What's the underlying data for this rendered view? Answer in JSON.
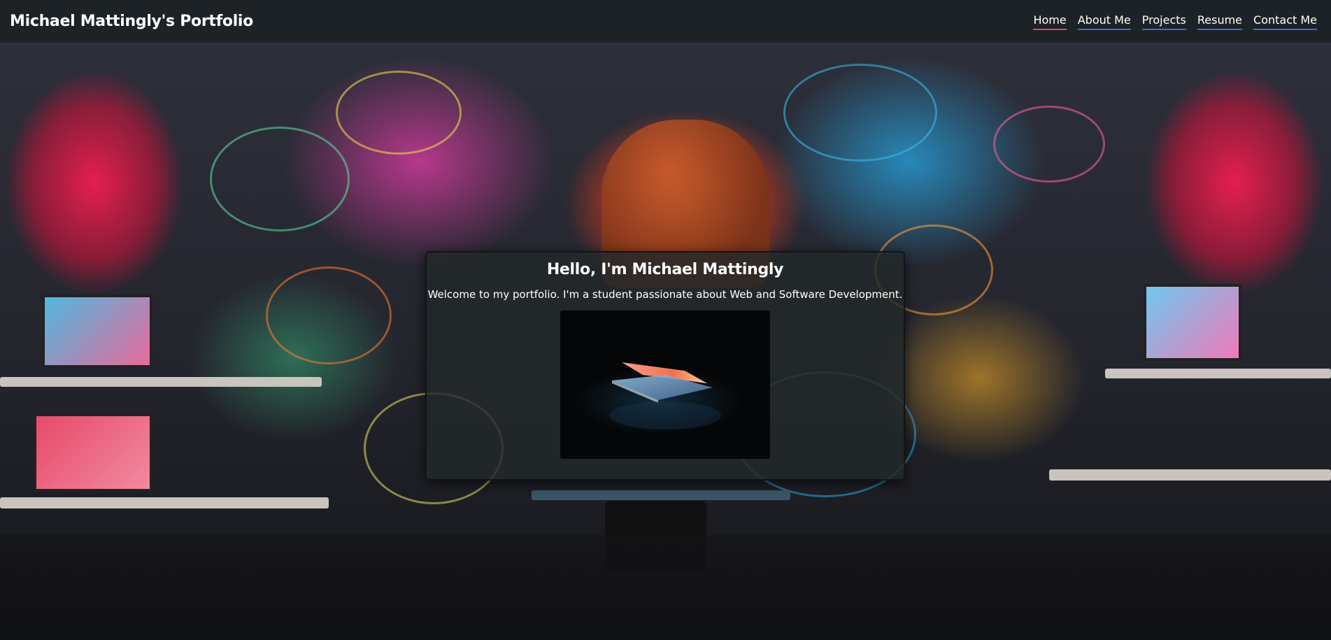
{
  "site": {
    "title": "Michael Mattingly's Portfolio"
  },
  "nav": {
    "items": [
      {
        "label": "Home",
        "active": true
      },
      {
        "label": "About Me",
        "active": false
      },
      {
        "label": "Projects",
        "active": false
      },
      {
        "label": "Resume",
        "active": false
      },
      {
        "label": "Contact Me",
        "active": false
      }
    ]
  },
  "hero": {
    "heading": "Hello, I'm Michael Mattingly",
    "intro": "Welcome to my portfolio. I'm a student passionate about Web and Software Development."
  },
  "colors": {
    "header_bg": "#1c2226",
    "nav_underline": "#3b6fd0",
    "nav_active_underline": "#d94c5a",
    "card_bg": "#22282a"
  },
  "images": {
    "background": "graffiti-workspace-mural",
    "hero": "glowing-laptop"
  }
}
